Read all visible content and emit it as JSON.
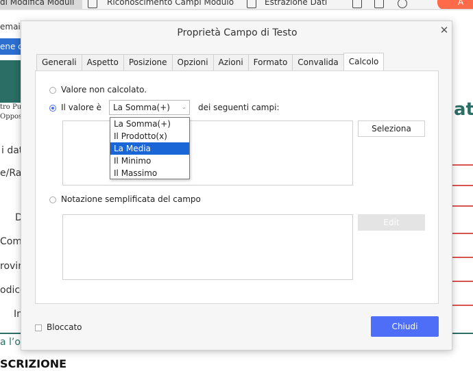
{
  "background": {
    "toolbar": {
      "item1": "di Modifica Moduli",
      "item2": "Riconoscimento Campi Modulo",
      "item3": "Estrazione Dati",
      "orange_label": "A"
    },
    "left": {
      "email": "email",
      "blue_strip": "ene c",
      "logo_text_1": "tro Pu",
      "logo_text_2": "Oppos",
      "labels": [
        "i dat",
        "e/Ra",
        "D",
        "Comu",
        "rovin",
        "odice",
        "In"
      ],
      "bottom_text": "a l’op",
      "section": "SCRIZIONE"
    },
    "right_heading": "ati",
    "colors": {
      "teal": "#2a6e66",
      "accent_red": "#d9534f",
      "orange": "#ff6b4a"
    }
  },
  "dialog": {
    "title": "Proprietà Campo di Testo",
    "close_icon": "close-icon",
    "tabs": [
      {
        "label": "Generali"
      },
      {
        "label": "Aspetto"
      },
      {
        "label": "Posizione"
      },
      {
        "label": "Opzioni"
      },
      {
        "label": "Azioni"
      },
      {
        "label": "Formato"
      },
      {
        "label": "Convalida"
      },
      {
        "label": "Calcolo"
      }
    ],
    "active_tab": "Calcolo",
    "calc": {
      "option_none": "Valore non calcolato.",
      "option_value_prefix": "Il valore è",
      "option_value_suffix": "dei seguenti campi:",
      "selected_function": "La Somma(+)",
      "function_options": [
        "La Somma(+)",
        "Il Prodotto(x)",
        "La Media",
        "Il Minimo",
        "Il Massimo"
      ],
      "highlighted_option": "La Media",
      "select_button": "Seleziona",
      "option_simplified": "Notazione semplificata del campo",
      "edit_button": "Edit"
    },
    "locked_label": "Bloccato",
    "close_button": "Chiudi",
    "colors": {
      "primary": "#4f6ef7",
      "highlight": "#1a66d6"
    }
  }
}
